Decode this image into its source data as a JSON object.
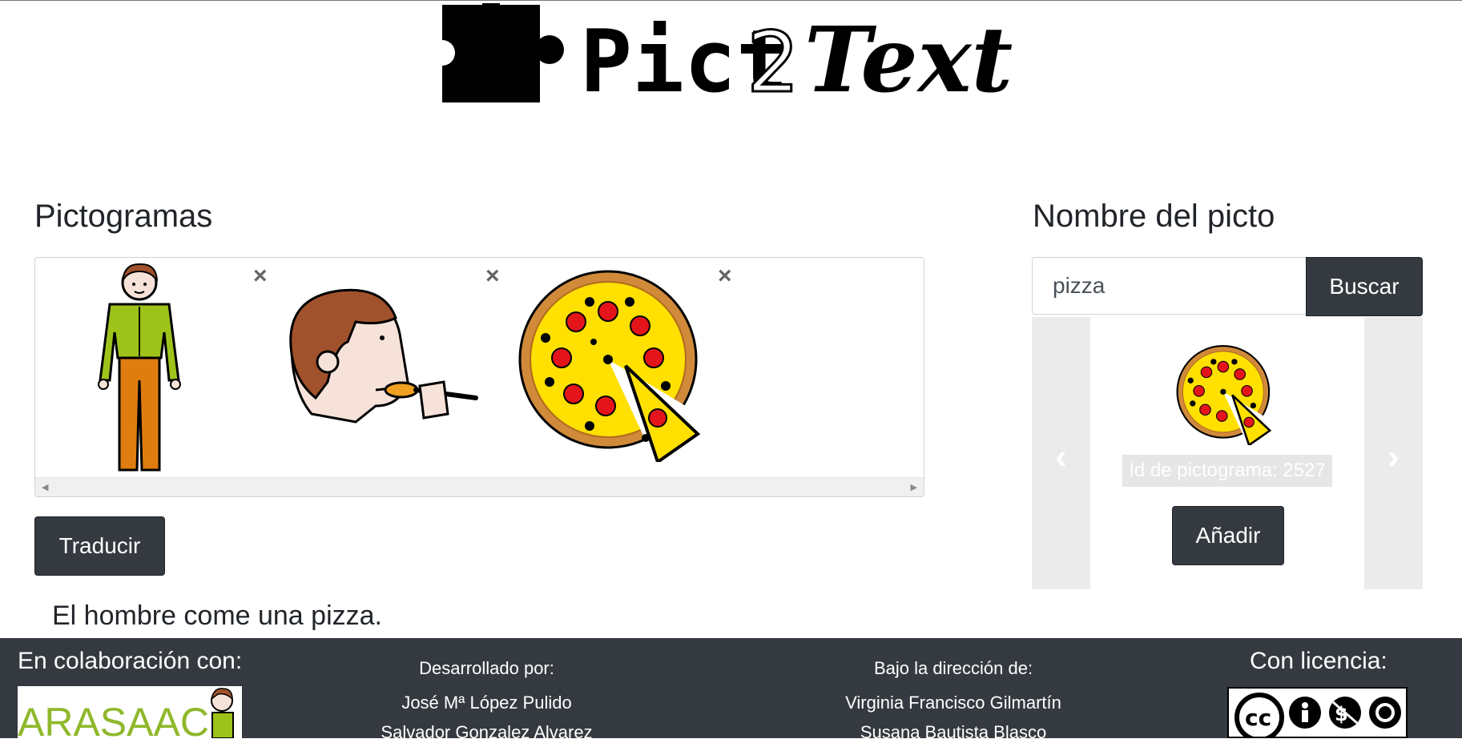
{
  "logo": {
    "text": "Pict2Text"
  },
  "pictograms": {
    "title": "Pictogramas",
    "items": [
      {
        "icon": "man-standing-icon",
        "remove": "×"
      },
      {
        "icon": "person-eating-icon",
        "remove": "×"
      },
      {
        "icon": "pizza-icon",
        "remove": "×"
      }
    ]
  },
  "actions": {
    "translate_label": "Traducir"
  },
  "result": {
    "text": "El hombre come una pizza."
  },
  "search": {
    "title": "Nombre del picto",
    "value": "pizza",
    "button_label": "Buscar",
    "caption": "Id de pictograma: 2527",
    "add_label": "Añadir",
    "prev_icon": "‹",
    "next_icon": "›"
  },
  "footer": {
    "collab_title": "En colaboración con:",
    "collab_logo_text": "ARASAAC",
    "dev_title": "Desarrollado por:",
    "dev_names": [
      "José Mª López Pulido",
      "Salvador Gonzalez Alvarez"
    ],
    "dir_title": "Bajo la dirección de:",
    "dir_names": [
      "Virginia Francisco Gilmartín",
      "Susana Bautista Blasco"
    ],
    "license_title": "Con licencia:",
    "license_text": "cc"
  },
  "colors": {
    "dark": "#343a40",
    "pizza_yellow": "#ffe000",
    "pepperoni": "#e4141b",
    "crust": "#d08a3a"
  }
}
